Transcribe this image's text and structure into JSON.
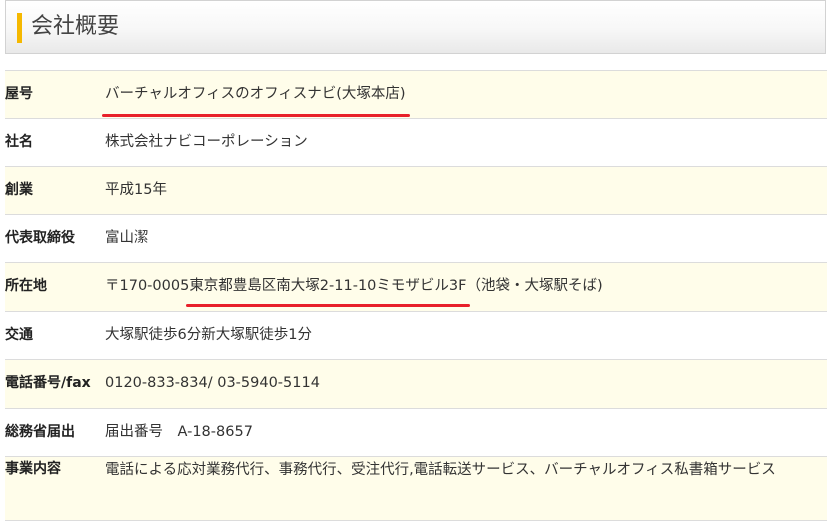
{
  "header": {
    "title": "会社概要",
    "accent_color": "#f5b800"
  },
  "rows": [
    {
      "label": "屋号",
      "value": "バーチャルオフィスのオフィスナビ(大塚本店)"
    },
    {
      "label": "社名",
      "value": "株式会社ナビコーポレーション"
    },
    {
      "label": "創業",
      "value": "平成15年"
    },
    {
      "label": "代表取締役",
      "value": "富山潔"
    },
    {
      "label": "所在地",
      "postal": "〒170-0005",
      "address": "東京都豊島区南大塚2-11-10ミモザビル3F",
      "note": "（池袋・大塚駅そば)"
    },
    {
      "label": "交通",
      "value": "大塚駅徒歩6分新大塚駅徒歩1分"
    },
    {
      "label": "電話番号/fax",
      "value": "0120-833-834/ 03-5940-5114"
    },
    {
      "label": "総務省届出",
      "value": "届出番号　A-18-8657"
    },
    {
      "label": "事業内容",
      "value": "電話による応対業務代行、事務代行、受注代行,電話転送サービス、バーチャルオフィス私書箱サービス"
    }
  ],
  "colors": {
    "row_highlight": "#fffdea",
    "underline": "#e8202a",
    "border": "#dcdcdc"
  }
}
